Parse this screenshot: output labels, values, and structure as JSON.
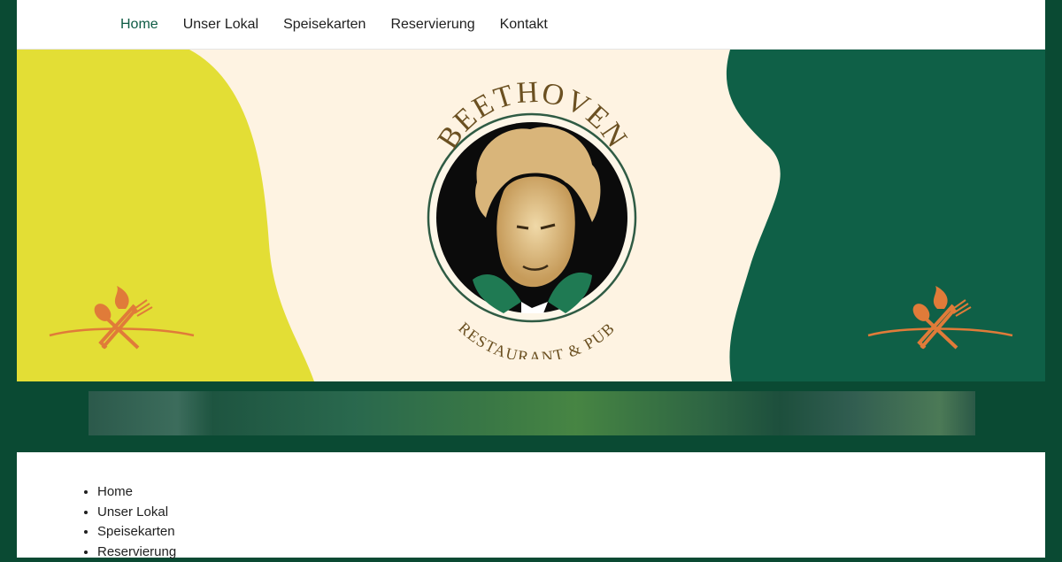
{
  "nav": {
    "items": [
      {
        "label": "Home",
        "active": true
      },
      {
        "label": "Unser Lokal",
        "active": false
      },
      {
        "label": "Speisekarten",
        "active": false
      },
      {
        "label": "Reservierung",
        "active": false
      },
      {
        "label": "Kontakt",
        "active": false
      }
    ]
  },
  "hero": {
    "logo": {
      "title": "BEETHOVEN",
      "subtitle": "RESTAURANT & PUB"
    },
    "decorations": {
      "left_icon": "utensils-fire-icon",
      "right_icon": "utensils-fire-icon"
    }
  },
  "content": {
    "list": [
      "Home",
      "Unser Lokal",
      "Speisekarten",
      "Reservierung"
    ]
  },
  "colors": {
    "page_bg": "#0a4a33",
    "nav_active": "#0d5b44",
    "hero_yellow": "#e3de35",
    "hero_green": "#0f6047",
    "hero_cream": "#fef3e2",
    "logo_brown": "#6b5021",
    "deco_orange": "#e07b39"
  }
}
